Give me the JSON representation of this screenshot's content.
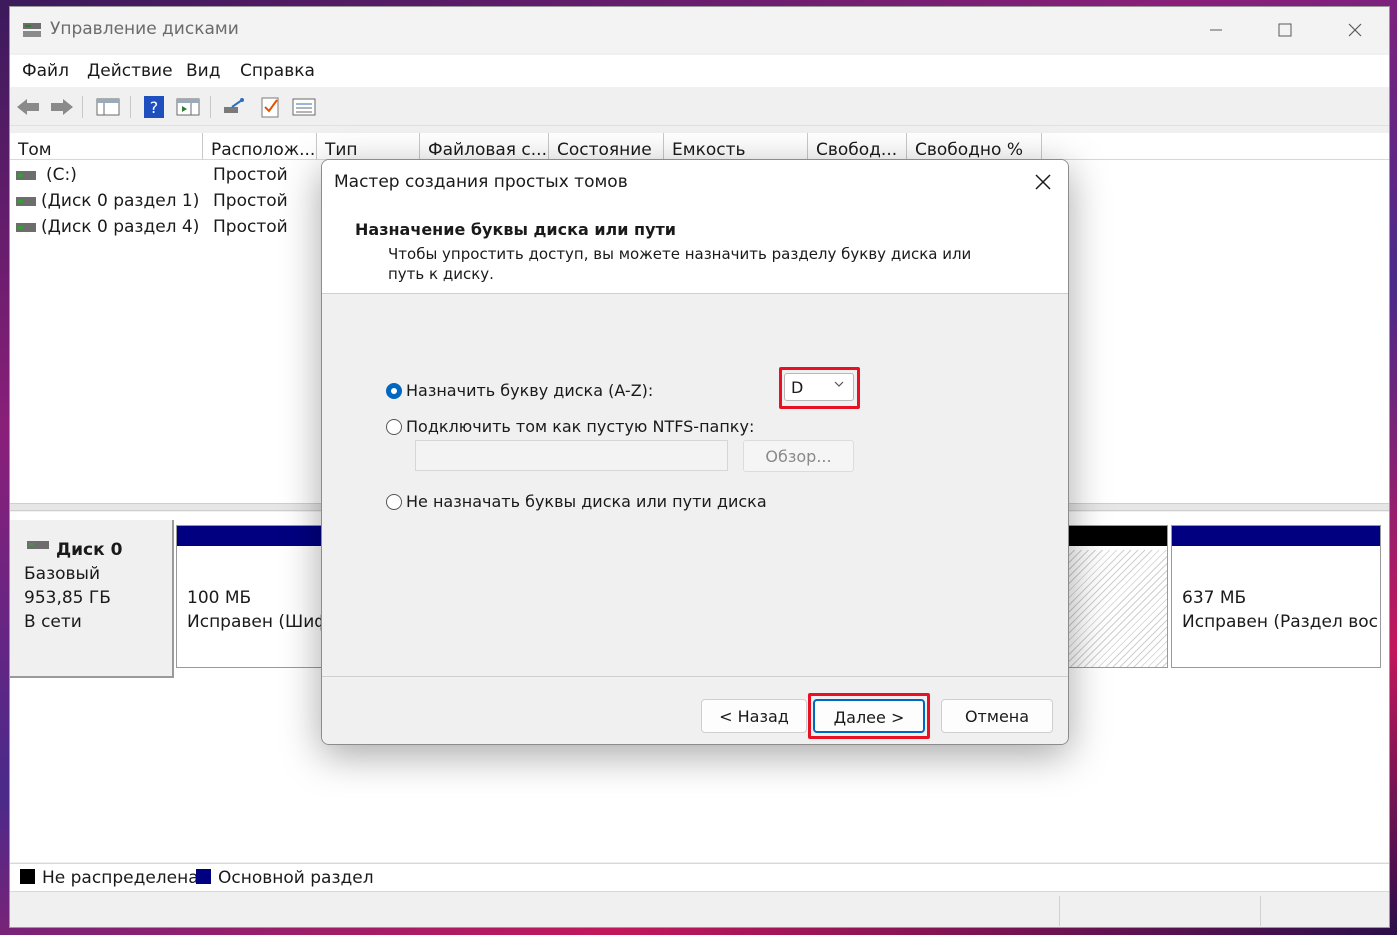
{
  "window": {
    "title": "Управление дисками"
  },
  "menu": [
    "Файл",
    "Действие",
    "Вид",
    "Справка"
  ],
  "table": {
    "columns": [
      "Том",
      "Располож...",
      "Тип",
      "Файловая с...",
      "Состояние",
      "Емкость",
      "Свобод...",
      "Свободно %"
    ],
    "rows": [
      {
        "name": "(C:)",
        "layout": "Простой"
      },
      {
        "name": "(Диск 0 раздел 1)",
        "layout": "Простой"
      },
      {
        "name": "(Диск 0 раздел 4)",
        "layout": "Простой"
      }
    ]
  },
  "disk": {
    "name": "Диск 0",
    "type": "Базовый",
    "size": "953,85 ГБ",
    "status": "В сети",
    "partitions": [
      {
        "size": "100 МБ",
        "status": "Исправен (Шиф"
      },
      {
        "size": "637 МБ",
        "status": "Исправен (Раздел восс"
      }
    ]
  },
  "legend": {
    "unallocated": "Не распределена",
    "primary": "Основной раздел"
  },
  "colors": {
    "primary": "#000080",
    "unallocated": "#000000",
    "highlight": "#e81123",
    "accent": "#0067c0"
  },
  "dialog": {
    "title": "Мастер создания простых томов",
    "heading": "Назначение буквы диска или пути",
    "subtitle": "Чтобы упростить доступ, вы можете назначить разделу букву диска или путь к диску.",
    "option_letter": "Назначить букву диска (A-Z):",
    "option_folder": "Подключить том как пустую NTFS-папку:",
    "option_none": "Не назначать буквы диска или пути диска",
    "selected_letter": "D",
    "browse": "Обзор...",
    "back": "< Назад",
    "next": "Далее >",
    "cancel": "Отмена"
  }
}
